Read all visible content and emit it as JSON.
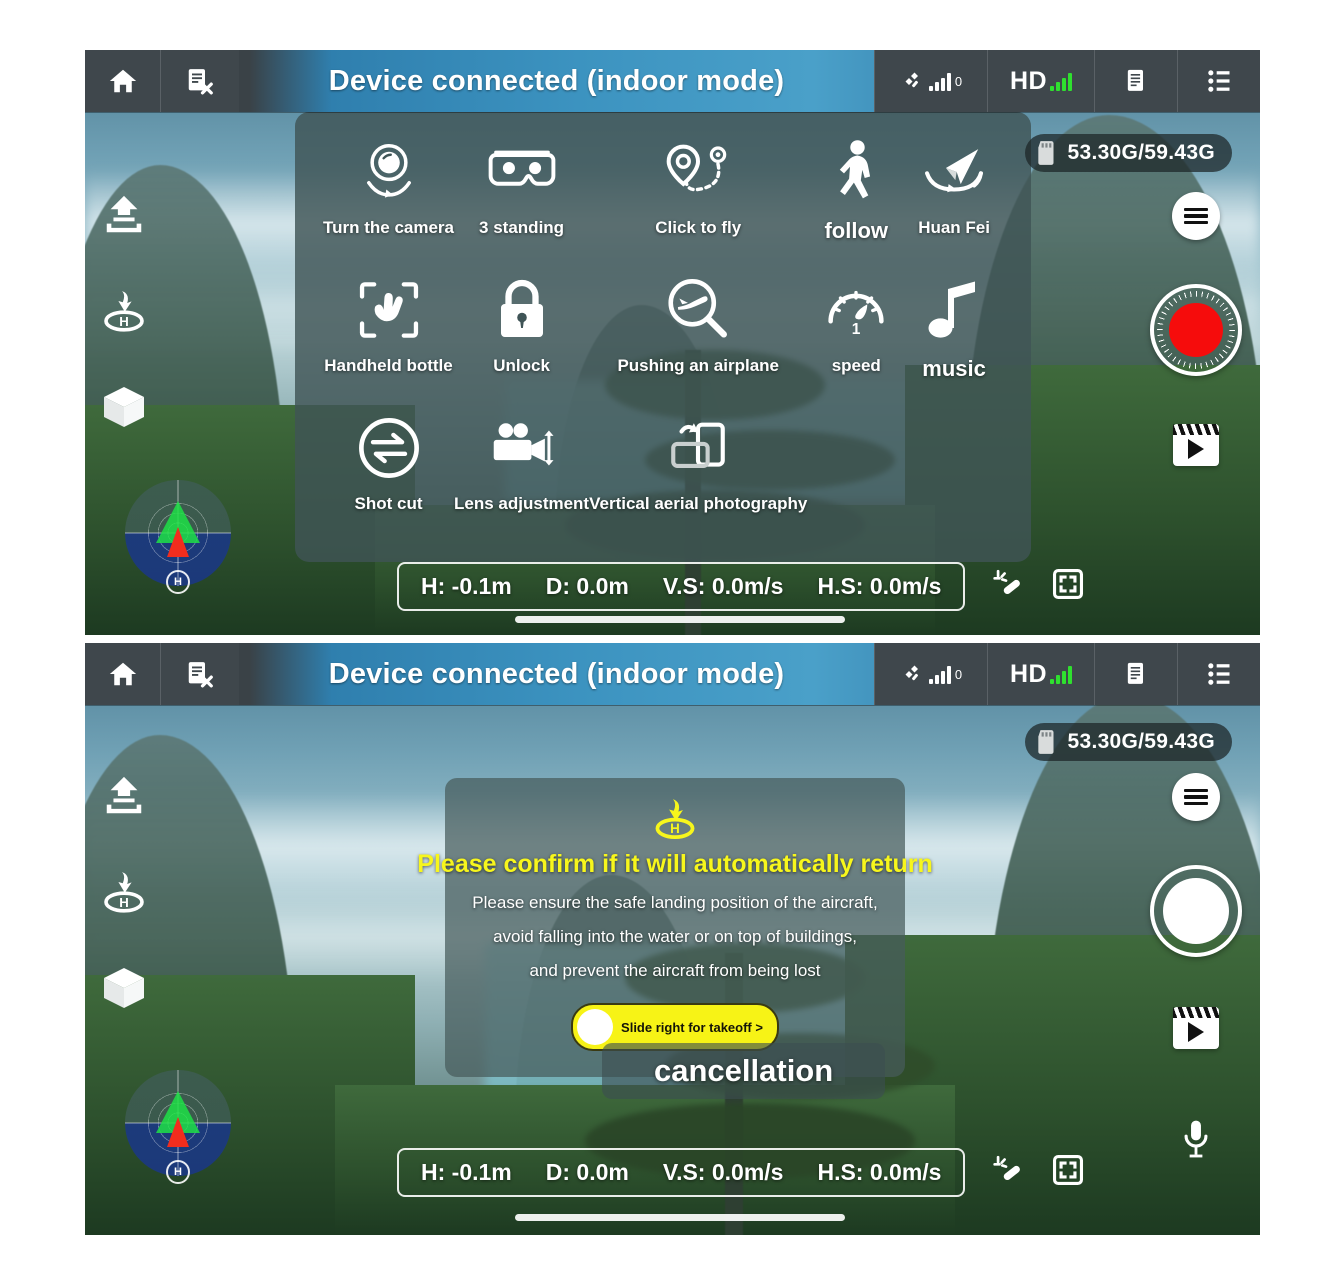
{
  "app": {
    "title": "Device connected (indoor mode)",
    "accent_yellow": "#F7F61C",
    "accent_blue": "#3C93C0",
    "record_red": "#F60C0C",
    "signal_green": "#2FE02F"
  },
  "topbar": {
    "home_icon": "home-icon",
    "doc_icon": "document-disconnect-icon",
    "title": "Device connected (indoor mode)",
    "satellite_icon": "satellite-icon",
    "satellite_count": "0",
    "hd_label": "HD",
    "hd_icon": "signal-bars-icon",
    "battery_icon": "battery-document-icon",
    "menu_icon": "list-menu-icon"
  },
  "storage": {
    "icon": "sd-card-icon",
    "text": "53.30G/59.43G"
  },
  "left_rail": [
    {
      "name": "takeoff-button",
      "icon": "takeoff-arrow-icon"
    },
    {
      "name": "return-home-button",
      "icon": "return-to-home-icon"
    },
    {
      "name": "three-d-view-button",
      "icon": "cube-icon"
    }
  ],
  "radar": {
    "name": "radar-compass",
    "heading_label": "H"
  },
  "right_rail_panel1": [
    {
      "name": "menu-button",
      "icon": "hamburger-icon"
    },
    {
      "name": "record-button",
      "icon": "record-dot-icon"
    },
    {
      "name": "gallery-button",
      "icon": "film-play-icon"
    }
  ],
  "right_rail_panel2": [
    {
      "name": "menu-button",
      "icon": "hamburger-icon"
    },
    {
      "name": "shutter-button",
      "icon": "shutter-circle-icon"
    },
    {
      "name": "gallery-button",
      "icon": "film-play-icon"
    },
    {
      "name": "microphone-button",
      "icon": "microphone-icon"
    }
  ],
  "telemetry": {
    "height": "H: -0.1m",
    "distance": "D: 0.0m",
    "vertical_speed": "V.S: 0.0m/s",
    "horizontal_speed": "H.S: 0.0m/s",
    "beautify_icon": "magic-wand-icon",
    "fullscreen_icon": "fullscreen-icon"
  },
  "function_menu": {
    "items": [
      {
        "label": "Turn the camera",
        "icon": "rotate-camera-icon",
        "big": false
      },
      {
        "label": "3 standing",
        "icon": "vr-goggles-icon",
        "big": false
      },
      {
        "label": "Click to fly",
        "icon": "waypoint-fly-icon",
        "big": false
      },
      {
        "label": "follow",
        "icon": "follow-person-icon",
        "big": true
      },
      {
        "label": "Huan Fei",
        "icon": "orbit-paperplane-icon",
        "big": false
      },
      {
        "label": "Handheld bottle",
        "icon": "gesture-palm-icon",
        "big": false
      },
      {
        "label": "Unlock",
        "icon": "lock-icon",
        "big": false
      },
      {
        "label": "Pushing an airplane",
        "icon": "magnifier-plane-icon",
        "big": false
      },
      {
        "label": "speed",
        "icon": "speedometer-icon",
        "big": false
      },
      {
        "label": "music",
        "icon": "music-note-icon",
        "big": true
      },
      {
        "label": "Shot cut",
        "icon": "swap-arrows-icon",
        "big": false
      },
      {
        "label": "Lens adjustment",
        "icon": "camera-updown-icon",
        "big": false
      },
      {
        "label": "Vertical aerial photography",
        "icon": "rotate-screen-icon",
        "big": false
      }
    ]
  },
  "confirm_dialog": {
    "icon": "return-to-home-icon",
    "title": "Please confirm if it will automatically return",
    "lines": [
      "Please ensure the safe landing position of the aircraft,",
      "avoid falling into the water or on top of buildings,",
      "and prevent the aircraft from being lost"
    ],
    "slider_label": "Slide right for takeoff >",
    "cancel_label": "cancellation"
  }
}
